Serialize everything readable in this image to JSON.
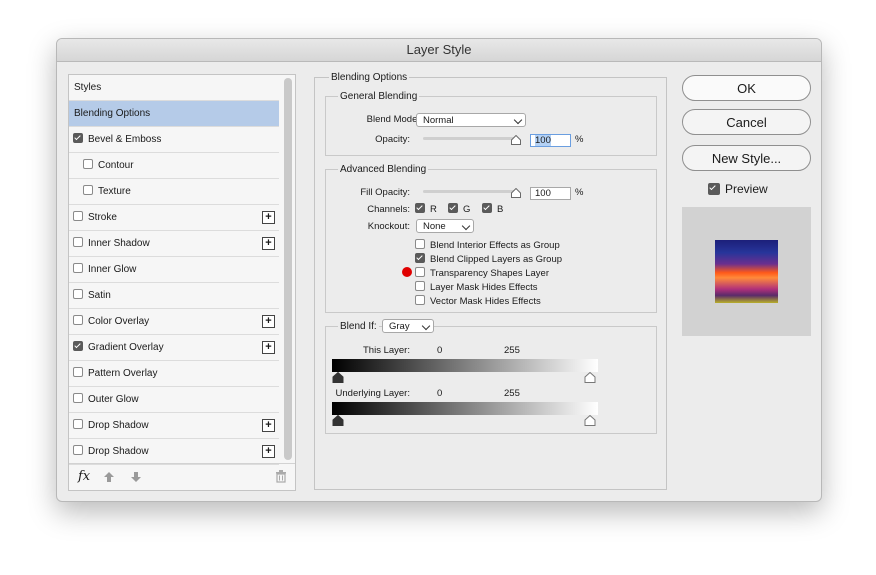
{
  "window": {
    "title": "Layer Style"
  },
  "styles_list": {
    "header": "Styles",
    "items": [
      {
        "label": "Blending Options",
        "checkbox": false,
        "checked": false,
        "plus": false,
        "selected": true,
        "indent": false
      },
      {
        "label": "Bevel & Emboss",
        "checkbox": true,
        "checked": true,
        "plus": false,
        "selected": false,
        "indent": false
      },
      {
        "label": "Contour",
        "checkbox": true,
        "checked": false,
        "plus": false,
        "selected": false,
        "indent": true
      },
      {
        "label": "Texture",
        "checkbox": true,
        "checked": false,
        "plus": false,
        "selected": false,
        "indent": true
      },
      {
        "label": "Stroke",
        "checkbox": true,
        "checked": false,
        "plus": true,
        "selected": false,
        "indent": false
      },
      {
        "label": "Inner Shadow",
        "checkbox": true,
        "checked": false,
        "plus": true,
        "selected": false,
        "indent": false
      },
      {
        "label": "Inner Glow",
        "checkbox": true,
        "checked": false,
        "plus": false,
        "selected": false,
        "indent": false
      },
      {
        "label": "Satin",
        "checkbox": true,
        "checked": false,
        "plus": false,
        "selected": false,
        "indent": false
      },
      {
        "label": "Color Overlay",
        "checkbox": true,
        "checked": false,
        "plus": true,
        "selected": false,
        "indent": false
      },
      {
        "label": "Gradient Overlay",
        "checkbox": true,
        "checked": true,
        "plus": true,
        "selected": false,
        "indent": false
      },
      {
        "label": "Pattern Overlay",
        "checkbox": true,
        "checked": false,
        "plus": false,
        "selected": false,
        "indent": false
      },
      {
        "label": "Outer Glow",
        "checkbox": true,
        "checked": false,
        "plus": false,
        "selected": false,
        "indent": false
      },
      {
        "label": "Drop Shadow",
        "checkbox": true,
        "checked": false,
        "plus": true,
        "selected": false,
        "indent": false
      },
      {
        "label": "Drop Shadow",
        "checkbox": true,
        "checked": false,
        "plus": true,
        "selected": false,
        "indent": false
      }
    ],
    "plus_symbol": "+",
    "fx_label": "fx"
  },
  "blending_options": {
    "title": "Blending Options",
    "general": {
      "title": "General Blending",
      "blend_mode_label": "Blend Mode:",
      "blend_mode_value": "Normal",
      "opacity_label": "Opacity:",
      "opacity_value": "100",
      "percent": "%"
    },
    "advanced": {
      "title": "Advanced Blending",
      "fill_opacity_label": "Fill Opacity:",
      "fill_opacity_value": "100",
      "percent": "%",
      "channels_label": "Channels:",
      "channels": [
        {
          "label": "R",
          "checked": true
        },
        {
          "label": "G",
          "checked": true
        },
        {
          "label": "B",
          "checked": true
        }
      ],
      "knockout_label": "Knockout:",
      "knockout_value": "None",
      "options": [
        {
          "label": "Blend Interior Effects as Group",
          "checked": false
        },
        {
          "label": "Blend Clipped Layers as Group",
          "checked": true
        },
        {
          "label": "Transparency Shapes Layer",
          "checked": false
        },
        {
          "label": "Layer Mask Hides Effects",
          "checked": false
        },
        {
          "label": "Vector Mask Hides Effects",
          "checked": false
        }
      ]
    },
    "blend_if": {
      "label": "Blend If:",
      "value": "Gray",
      "this_layer_label": "This Layer:",
      "this_layer_min": "0",
      "this_layer_max": "255",
      "underlying_label": "Underlying Layer:",
      "underlying_min": "0",
      "underlying_max": "255"
    }
  },
  "buttons": {
    "ok": "OK",
    "cancel": "Cancel",
    "new_style": "New Style..."
  },
  "preview": {
    "label": "Preview",
    "checked": true
  },
  "colors": {
    "selected_row": "#b5cbe8",
    "marker": "#e00000",
    "field_highlight": "#b3d1f5"
  }
}
